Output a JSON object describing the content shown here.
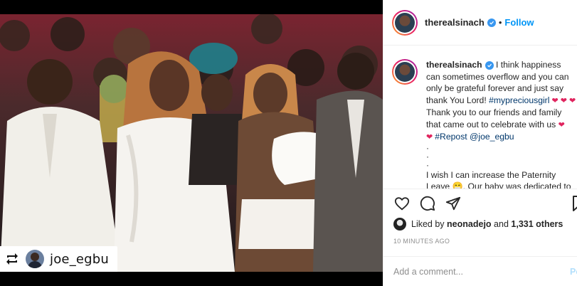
{
  "photo": {
    "scene_label": "Five people standing at a church dedication service, one woman holding a baby in white",
    "repost_tag": {
      "icon": "repost-icon",
      "username": "joe_egbu"
    }
  },
  "post_header": {
    "username": "therealsinach",
    "verified_icon": "verified-badge-icon",
    "separator": "•",
    "follow_label": "Follow"
  },
  "caption": {
    "username": "therealsinach",
    "line1": " I think happiness can sometimes overflow and you can only be grateful forever and just say thank You Lord! ",
    "hashtag": "#mypreciousgirl",
    "hearts1": " ❤ ❤ ❤ ",
    "line2": "Thank you to our friends and family that came out to celebrate with us ",
    "heart2": "❤",
    "heart3": "❤ ",
    "repost_text": "#Repost @joe_egbu",
    "dots": "·\n·\n·",
    "line3": "I wish I can increase the Paternity Leave ",
    "emoji": "😁",
    "line4": ". Our baby was dedicated to JESUS CHRIST yesterday"
  },
  "actions": {
    "like_icon": "heart-icon",
    "comment_icon": "comment-icon",
    "share_icon": "share-icon",
    "save_icon": "bookmark-icon"
  },
  "likes": {
    "prefix": "Liked by ",
    "user": "neonadejo",
    "middle": " and ",
    "count": "1,331 others"
  },
  "timestamp": "10 MINUTES AGO",
  "comment": {
    "placeholder": "Add a comment...",
    "post_label": "Post"
  },
  "colors": {
    "link_blue": "#0095f6",
    "hashtag_blue": "#00376b",
    "heart_red": "#e0245e",
    "verified_blue": "#3897f0"
  }
}
